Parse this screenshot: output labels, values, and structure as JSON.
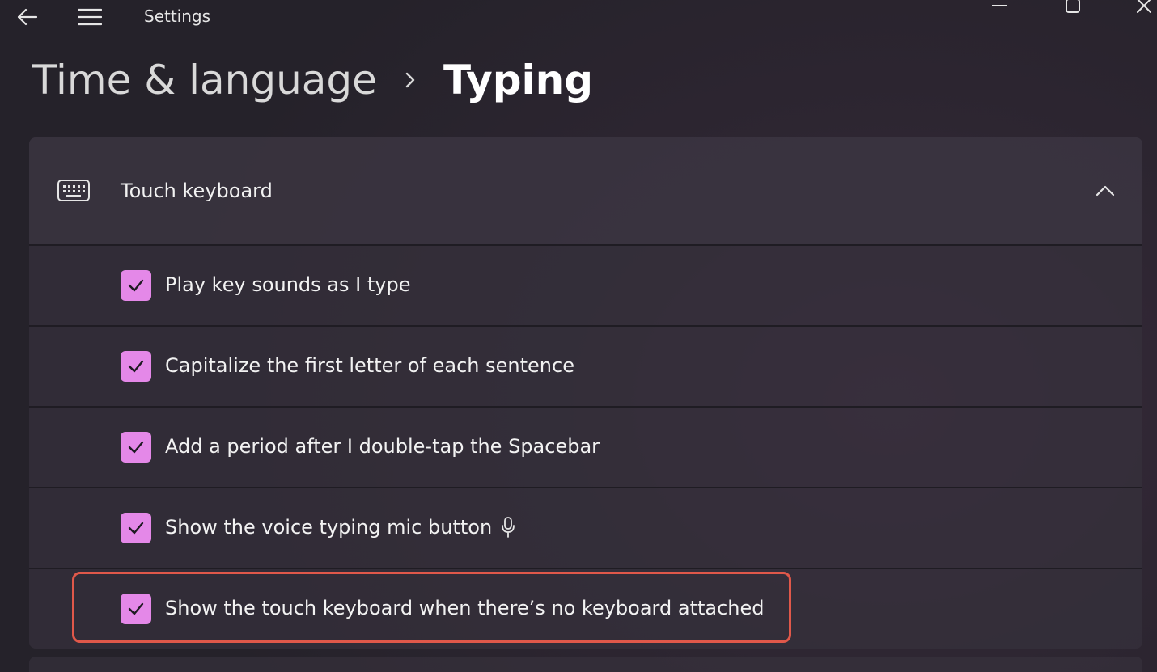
{
  "window": {
    "title": "Settings",
    "back_icon": "back-arrow-icon",
    "menu_icon": "hamburger-menu-icon",
    "controls": [
      "minimize-icon",
      "maximize-icon",
      "close-icon"
    ]
  },
  "breadcrumb": {
    "parent": "Time & language",
    "separator_icon": "chevron-right-icon",
    "current": "Typing"
  },
  "section": {
    "icon": "keyboard-icon",
    "title": "Touch keyboard",
    "expanded": true,
    "collapse_icon": "chevron-up-icon",
    "options": [
      {
        "label": "Play key sounds as I type",
        "checked": true
      },
      {
        "label": "Capitalize the first letter of each sentence",
        "checked": true
      },
      {
        "label": "Add a period after I double-tap the Spacebar",
        "checked": true
      },
      {
        "label": "Show the voice typing mic button",
        "checked": true,
        "trailing_icon": "microphone-icon"
      },
      {
        "label": "Show the touch keyboard when there’s no keyboard attached",
        "checked": true,
        "highlighted": true
      }
    ]
  },
  "colors": {
    "accent": "#e488e8",
    "highlight_border": "#e0584a"
  }
}
